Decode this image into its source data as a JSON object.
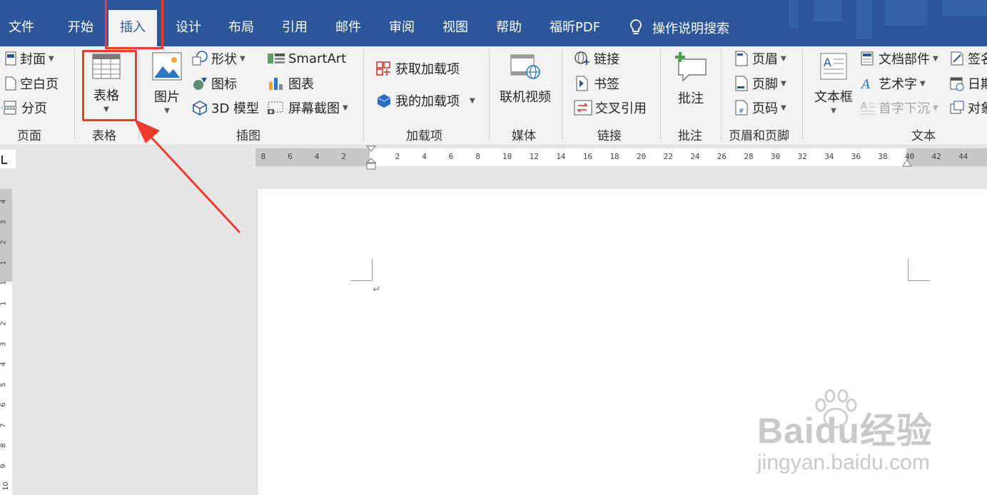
{
  "menu": {
    "tabs": [
      "文件",
      "开始",
      "插入",
      "设计",
      "布局",
      "引用",
      "邮件",
      "审阅",
      "视图",
      "帮助",
      "福昕PDF"
    ],
    "active_tab": "插入",
    "tell_me": "操作说明搜索"
  },
  "ribbon": {
    "pages": {
      "label": "页面",
      "cover": "封面",
      "blank": "空白页",
      "break": "分页"
    },
    "tables": {
      "label": "表格",
      "table": "表格"
    },
    "illustrations": {
      "label": "插图",
      "picture": "图片",
      "shapes": "形状",
      "icons": "图标",
      "model3d": "3D 模型",
      "smartart": "SmartArt",
      "chart": "图表",
      "screenshot": "屏幕截图"
    },
    "addins": {
      "label": "加载项",
      "get": "获取加载项",
      "my": "我的加载项"
    },
    "media": {
      "label": "媒体",
      "video": "联机视频"
    },
    "links": {
      "label": "链接",
      "link": "链接",
      "bookmark": "书签",
      "crossref": "交叉引用"
    },
    "comments": {
      "label": "批注",
      "comment": "批注"
    },
    "header_footer": {
      "label": "页眉和页脚",
      "header": "页眉",
      "footer": "页脚",
      "page_number": "页码"
    },
    "text": {
      "label": "文本",
      "textbox": "文本框",
      "quick_parts": "文档部件",
      "wordart": "艺术字",
      "dropcap": "首字下沉",
      "signature": "签名",
      "datetime": "日期",
      "object": "对象"
    }
  },
  "ruler": {
    "left_ticks": [
      "8",
      "6",
      "4",
      "2"
    ],
    "right_ticks": [
      "2",
      "4",
      "6",
      "8",
      "10",
      "12",
      "14",
      "16",
      "18",
      "20",
      "22",
      "24",
      "26",
      "28",
      "30",
      "32",
      "34",
      "36",
      "38",
      "40",
      "42",
      "44"
    ],
    "vertical_ticks": [
      "4",
      "3",
      "2",
      "1",
      "1",
      "1",
      "2",
      "3",
      "4",
      "5",
      "6",
      "7",
      "8",
      "9",
      "10"
    ]
  },
  "document": {
    "paragraph_mark": "↵"
  },
  "watermark": {
    "logo": "Baidu经验",
    "url": "jingyan.baidu.com"
  },
  "colors": {
    "accent": "#2b579a",
    "highlight": "#f03a2e"
  }
}
